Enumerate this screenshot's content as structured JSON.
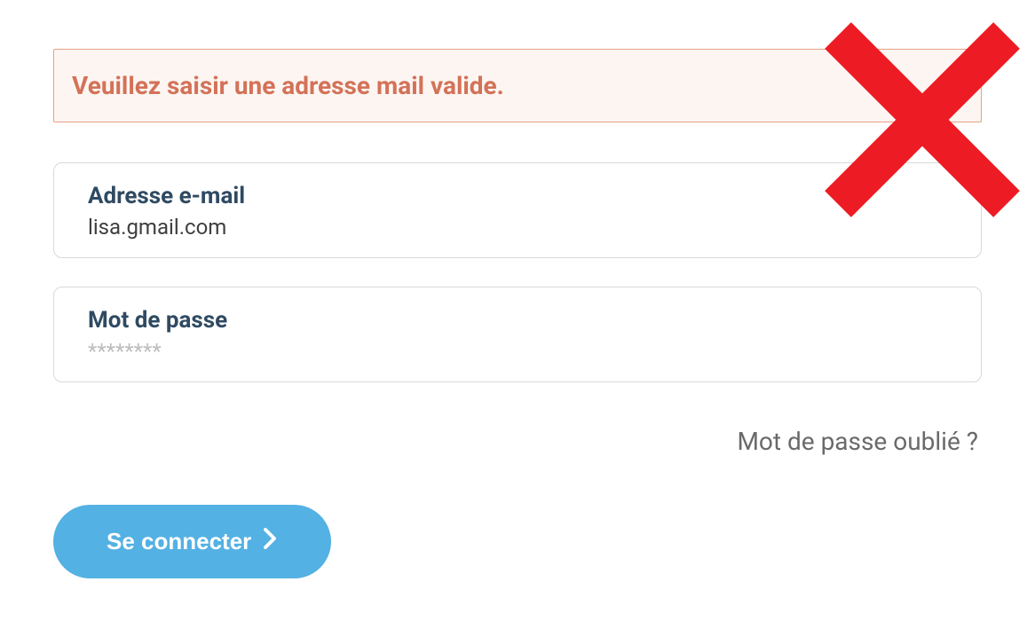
{
  "alert": {
    "message": "Veuillez saisir une adresse mail valide."
  },
  "email": {
    "label": "Adresse e-mail",
    "value": "lisa.gmail.com"
  },
  "password": {
    "label": "Mot de passe",
    "placeholder": "********"
  },
  "forgot": {
    "label": "Mot de passe oublié ?"
  },
  "login": {
    "label": "Se connecter"
  },
  "colors": {
    "alert_border": "#e9a085",
    "alert_bg": "#fdf5f2",
    "alert_text": "#d37258",
    "button_bg": "#53b1e3",
    "cross": "#ed1c24"
  }
}
